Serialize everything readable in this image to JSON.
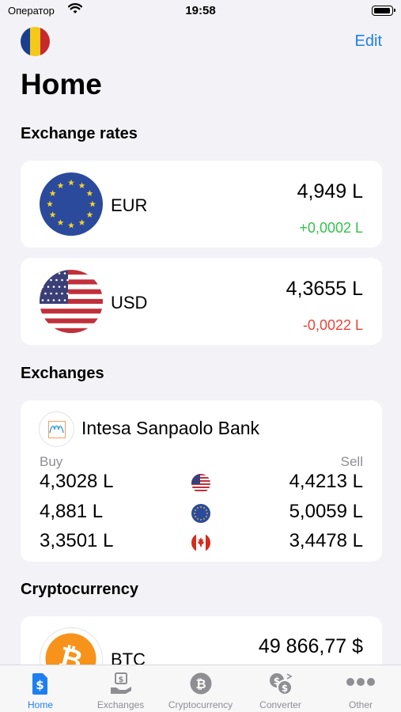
{
  "status_bar": {
    "carrier": "Оператор",
    "time": "19:58"
  },
  "header": {
    "edit_label": "Edit",
    "title": "Home"
  },
  "sections": {
    "exchange_rates": "Exchange rates",
    "exchanges": "Exchanges",
    "cryptocurrency": "Cryptocurrency"
  },
  "rates": [
    {
      "code": "EUR",
      "value": "4,949 L",
      "change": "+0,0002 L",
      "trend": "up",
      "icon": "eu-flag-icon"
    },
    {
      "code": "USD",
      "value": "4,3655 L",
      "change": "-0,0022 L",
      "trend": "down",
      "icon": "us-flag-icon"
    }
  ],
  "exchange": {
    "bank_name": "Intesa Sanpaolo Bank",
    "buy_label": "Buy",
    "sell_label": "Sell",
    "rows": [
      {
        "buy": "4,3028 L",
        "sell": "4,4213 L",
        "icon": "us-flag-icon"
      },
      {
        "buy": "4,881 L",
        "sell": "5,0059 L",
        "icon": "eu-flag-icon"
      },
      {
        "buy": "3,3501 L",
        "sell": "3,4478 L",
        "icon": "ca-flag-icon"
      }
    ]
  },
  "crypto": [
    {
      "code": "BTC",
      "value": "49 866,77 $",
      "icon": "bitcoin-icon"
    }
  ],
  "tabs": [
    {
      "label": "Home",
      "icon": "dollar-doc-icon",
      "active": true
    },
    {
      "label": "Exchanges",
      "icon": "bank-hand-icon",
      "active": false
    },
    {
      "label": "Cryptocurrency",
      "icon": "bitcoin-icon",
      "active": false
    },
    {
      "label": "Converter",
      "icon": "coins-exchange-icon",
      "active": false
    },
    {
      "label": "Other",
      "icon": "ellipsis-icon",
      "active": false
    }
  ],
  "colors": {
    "accent": "#1e7ff0",
    "positive": "#33c24d",
    "negative": "#e8443a",
    "background": "#f2f2f7"
  }
}
